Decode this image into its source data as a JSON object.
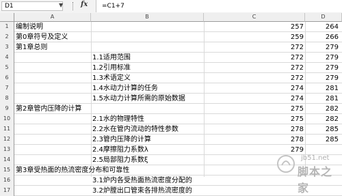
{
  "formula_bar": {
    "name_box": "D1",
    "fx_label": "fx",
    "formula": "=C1+7"
  },
  "columns": [
    "A",
    "B",
    "C",
    "D"
  ],
  "rows": [
    {
      "num": "1",
      "a": "编制说明",
      "b": "",
      "c": "257",
      "d": "264"
    },
    {
      "num": "2",
      "a": "第0章符号及定义",
      "b": "",
      "c": "259",
      "d": "266"
    },
    {
      "num": "3",
      "a": "第1章总则",
      "b": "",
      "c": "272",
      "d": "279"
    },
    {
      "num": "4",
      "a": "",
      "b": "1.1适用范围",
      "c": "272",
      "d": "279"
    },
    {
      "num": "5",
      "a": "",
      "b": "1.2引用标准",
      "c": "272",
      "d": "279"
    },
    {
      "num": "6",
      "a": "",
      "b": "1.3术语定义",
      "c": "272",
      "d": "279"
    },
    {
      "num": "7",
      "a": "",
      "b": "1.4水动力计算的任务",
      "c": "274",
      "d": "281"
    },
    {
      "num": "8",
      "a": "",
      "b": "1.5水动力计算所需的原始数据",
      "c": "274",
      "d": "281"
    },
    {
      "num": "9",
      "a": "第2章管内压降的计算",
      "b": "",
      "c": "275",
      "d": "282"
    },
    {
      "num": "10",
      "a": "",
      "b": "2.1水的物理特性",
      "c": "275",
      "d": "282"
    },
    {
      "num": "11",
      "a": "",
      "b": "2.2水在管内流动的特性参数",
      "c": "278",
      "d": "285"
    },
    {
      "num": "12",
      "a": "",
      "b": "2.3管内压降的计算",
      "c": "278",
      "d": "285"
    },
    {
      "num": "13",
      "a": "",
      "b": "2.4摩擦阻力系数λ",
      "c": "279",
      "d": ""
    },
    {
      "num": "14",
      "a": "",
      "b": "2.5局部阻力系数ξ",
      "c": "",
      "d": ""
    },
    {
      "num": "15",
      "a": "第3章受热面的热流密度分布和可靠性",
      "b": "",
      "c": "",
      "d": ""
    },
    {
      "num": "16",
      "a": "",
      "b": "3.1炉内各受热面热流密度分配的",
      "c": "",
      "d": ""
    },
    {
      "num": "17",
      "a": "",
      "b": "3.2炉膛出口管束各排热流密度的",
      "c": "",
      "d": ""
    }
  ],
  "watermark": {
    "url_text": "jb51.net",
    "brand_text": "脚本之家"
  }
}
